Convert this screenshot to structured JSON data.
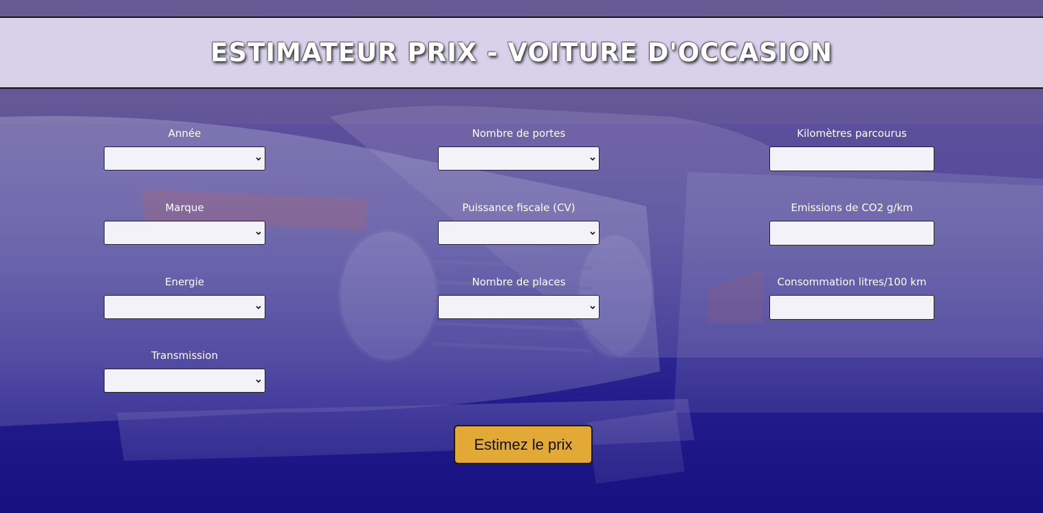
{
  "header": {
    "title": "ESTIMATEUR PRIX - VOITURE D'OCCASION"
  },
  "form": {
    "annee": {
      "label": "Année",
      "value": ""
    },
    "nombre_portes": {
      "label": "Nombre de portes",
      "value": ""
    },
    "kilometres": {
      "label": "Kilomètres parcourus",
      "value": ""
    },
    "marque": {
      "label": "Marque",
      "value": ""
    },
    "puissance": {
      "label": "Puissance fiscale (CV)",
      "value": ""
    },
    "emissions": {
      "label": "Emissions de CO2 g/km",
      "value": ""
    },
    "energie": {
      "label": "Energie",
      "value": ""
    },
    "nombre_places": {
      "label": "Nombre de places",
      "value": ""
    },
    "consommation": {
      "label": "Consommation litres/100 km",
      "value": ""
    },
    "transmission": {
      "label": "Transmission",
      "value": ""
    }
  },
  "submit": {
    "label": "Estimez le prix",
    "color": "#e3a937"
  },
  "background": {
    "icon": "vintage-cars-photo"
  }
}
